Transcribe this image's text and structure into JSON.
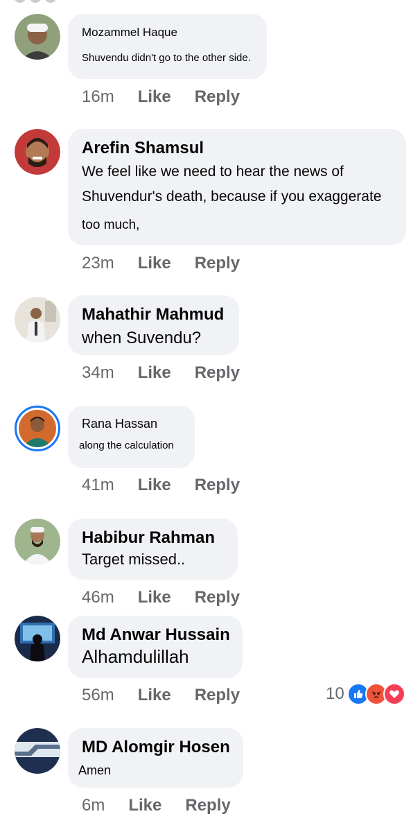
{
  "comments": [
    {
      "name": "Mozammel Haque",
      "text": "Shuvendu didn't go to the other side.",
      "time": "16m",
      "like": "Like",
      "reply": "Reply"
    },
    {
      "name": "Arefin Shamsul",
      "text_lines": [
        "We feel like we need to hear the news of",
        "Shuvendur's death, because if you exaggerate",
        "too much,"
      ],
      "time": "23m",
      "like": "Like",
      "reply": "Reply"
    },
    {
      "name": "Mahathir Mahmud",
      "text": "when Suvendu?",
      "time": "34m",
      "like": "Like",
      "reply": "Reply"
    },
    {
      "name": "Rana Hassan",
      "text": "along the calculation",
      "time": "41m",
      "like": "Like",
      "reply": "Reply"
    },
    {
      "name": "Habibur Rahman",
      "text": "Target missed..",
      "time": "46m",
      "like": "Like",
      "reply": "Reply"
    },
    {
      "name": "Md Anwar Hussain",
      "text": "Alhamdulillah",
      "time": "56m",
      "like": "Like",
      "reply": "Reply",
      "reactions": {
        "count": "10",
        "icons": [
          "like-icon",
          "angry-icon",
          "love-icon"
        ]
      }
    },
    {
      "name": "MD Alomgir Hosen",
      "text": "Amen",
      "time": "6m",
      "like": "Like",
      "reply": "Reply"
    }
  ],
  "colors": {
    "bubble": "#f0f2f5",
    "meta": "#65676b",
    "like_blue": "#1877f2",
    "angry": "#f0533a",
    "love": "#f33e58"
  }
}
